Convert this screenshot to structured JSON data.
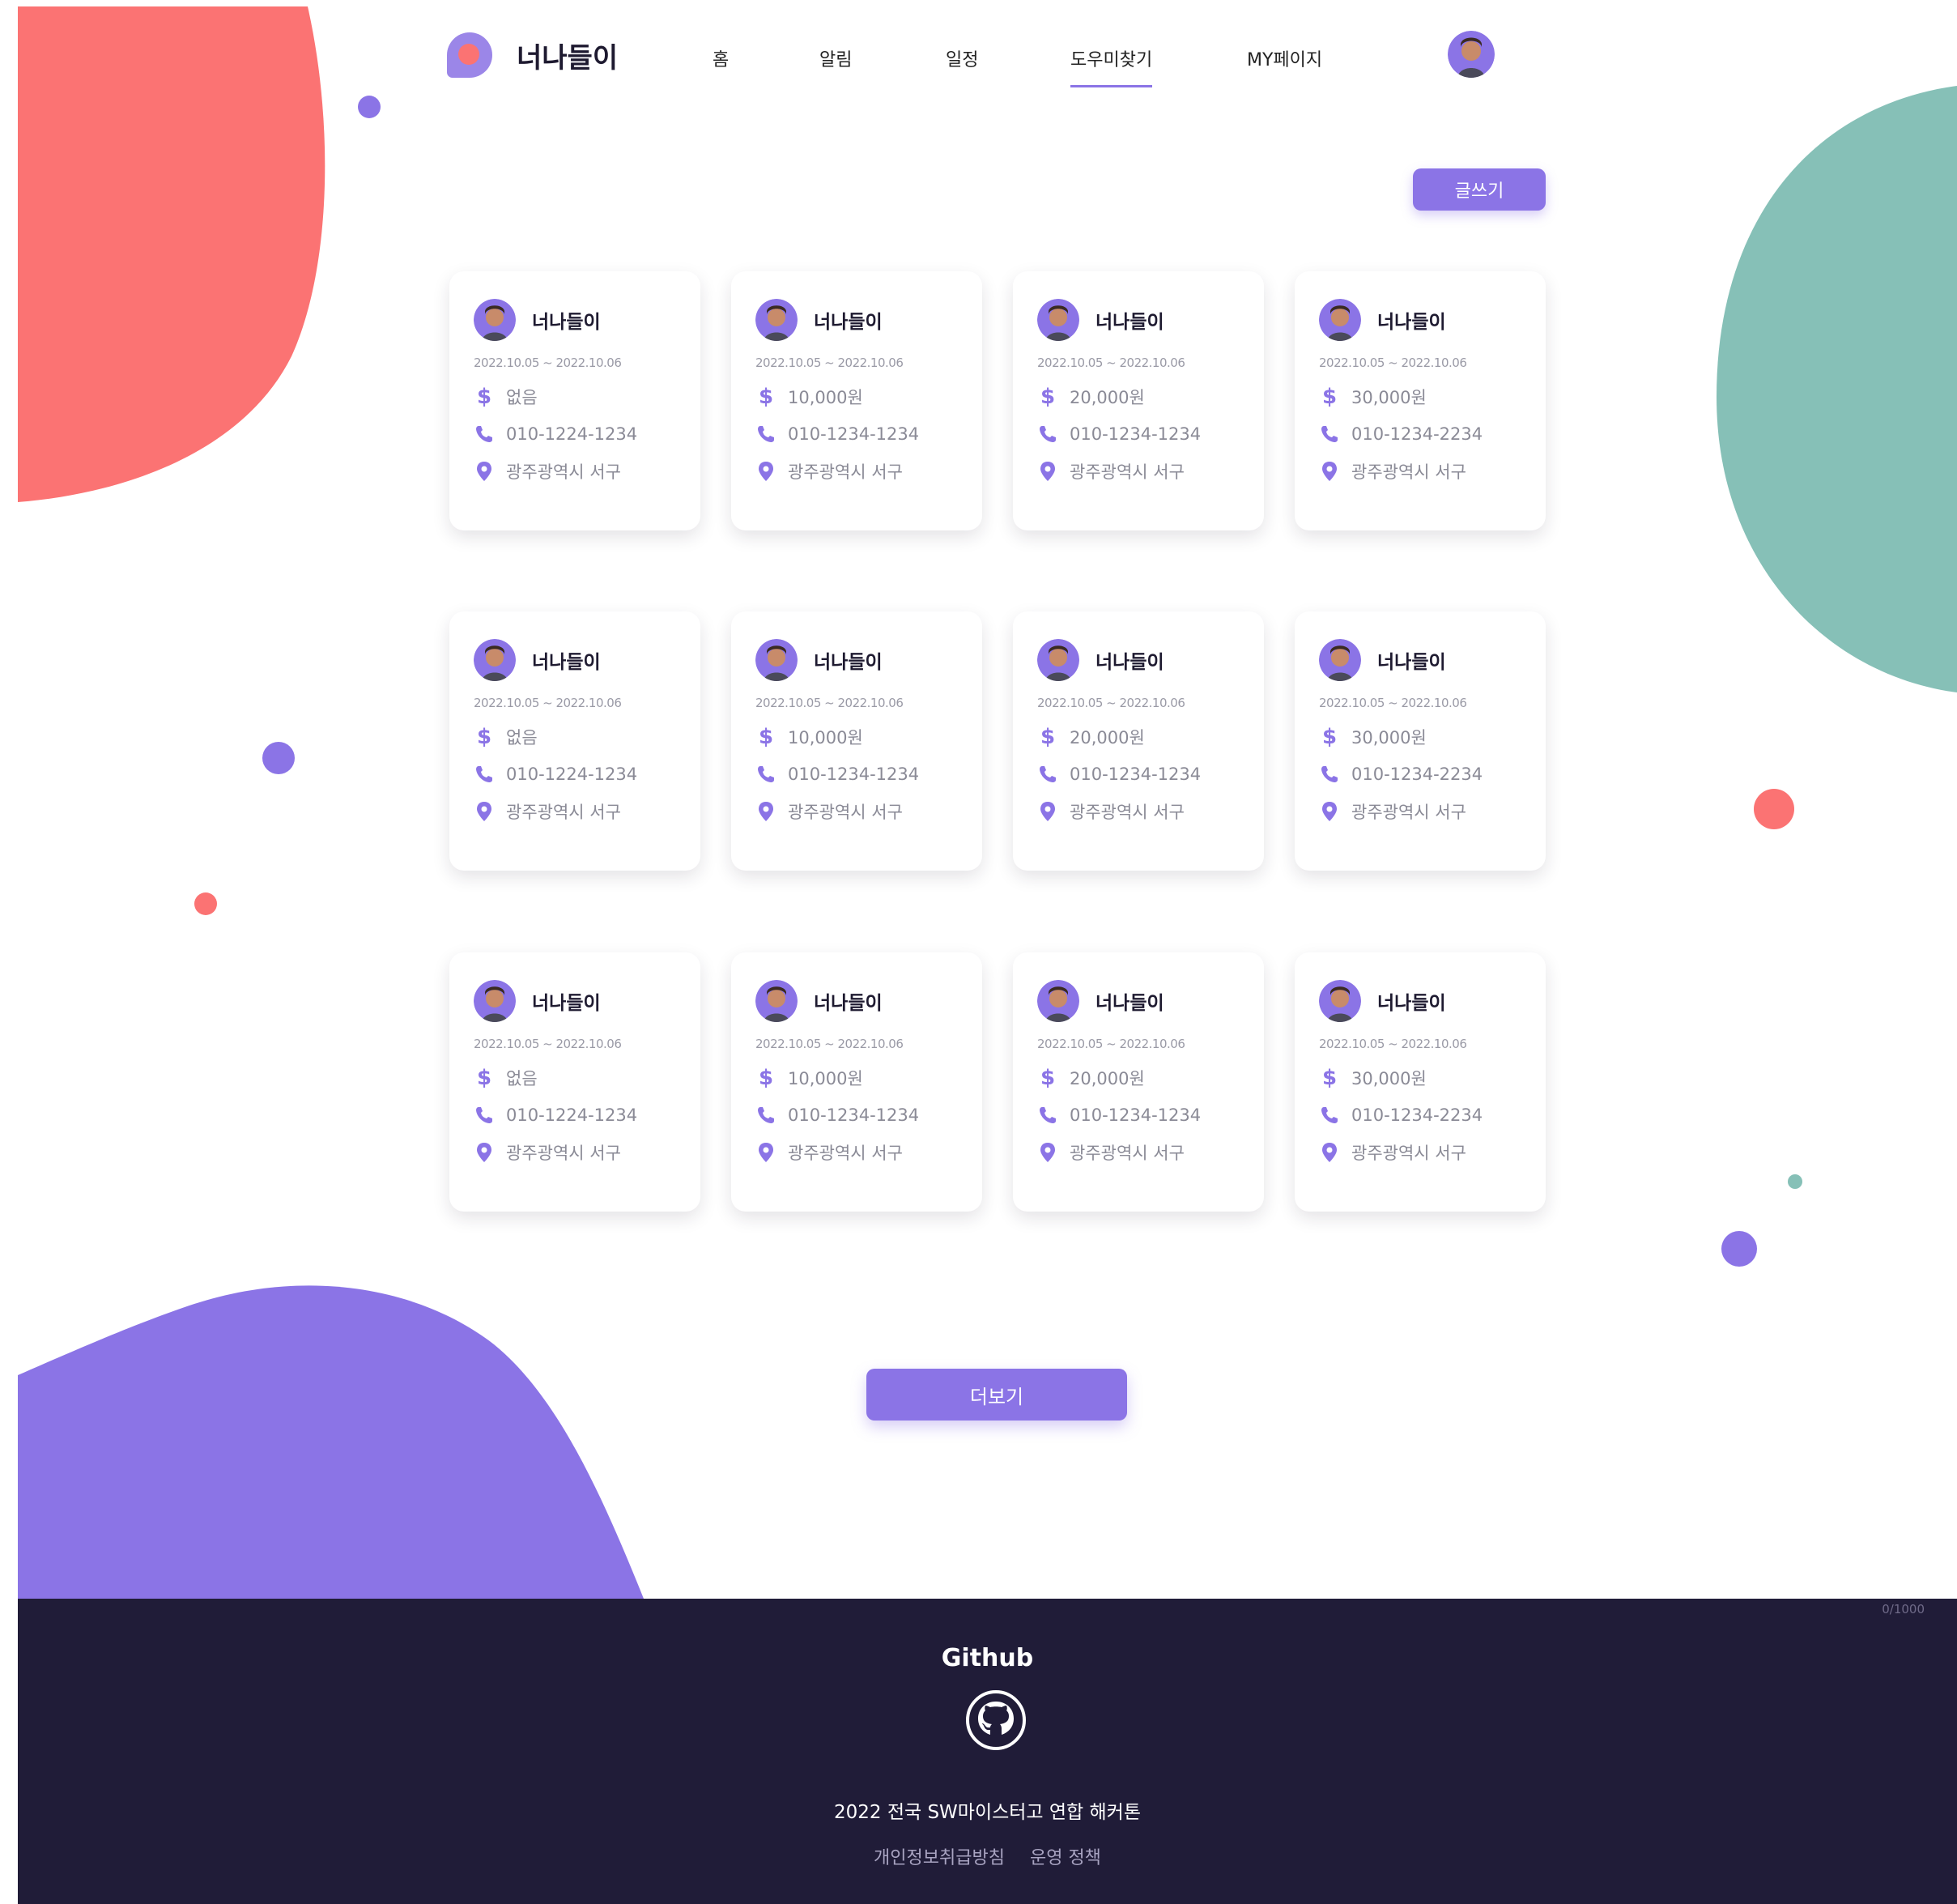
{
  "header": {
    "brand": "너나들이",
    "nav": [
      "홈",
      "알림",
      "일정",
      "도우미찾기",
      "MY페이지"
    ],
    "active_nav": "도우미찾기"
  },
  "write_button": "글쓰기",
  "cards": [
    {
      "name": "너나들이",
      "date": "2022.10.05 ~ 2022.10.06",
      "pay": "없음",
      "phone": "010-1224-1234",
      "location": "광주광역시 서구"
    },
    {
      "name": "너나들이",
      "date": "2022.10.05 ~ 2022.10.06",
      "pay": "10,000원",
      "phone": "010-1234-1234",
      "location": "광주광역시 서구"
    },
    {
      "name": "너나들이",
      "date": "2022.10.05 ~ 2022.10.06",
      "pay": "20,000원",
      "phone": "010-1234-1234",
      "location": "광주광역시 서구"
    },
    {
      "name": "너나들이",
      "date": "2022.10.05 ~ 2022.10.06",
      "pay": "30,000원",
      "phone": "010-1234-2234",
      "location": "광주광역시 서구"
    },
    {
      "name": "너나들이",
      "date": "2022.10.05 ~ 2022.10.06",
      "pay": "없음",
      "phone": "010-1224-1234",
      "location": "광주광역시 서구"
    },
    {
      "name": "너나들이",
      "date": "2022.10.05 ~ 2022.10.06",
      "pay": "10,000원",
      "phone": "010-1234-1234",
      "location": "광주광역시 서구"
    },
    {
      "name": "너나들이",
      "date": "2022.10.05 ~ 2022.10.06",
      "pay": "20,000원",
      "phone": "010-1234-1234",
      "location": "광주광역시 서구"
    },
    {
      "name": "너나들이",
      "date": "2022.10.05 ~ 2022.10.06",
      "pay": "30,000원",
      "phone": "010-1234-2234",
      "location": "광주광역시 서구"
    },
    {
      "name": "너나들이",
      "date": "2022.10.05 ~ 2022.10.06",
      "pay": "없음",
      "phone": "010-1224-1234",
      "location": "광주광역시 서구"
    },
    {
      "name": "너나들이",
      "date": "2022.10.05 ~ 2022.10.06",
      "pay": "10,000원",
      "phone": "010-1234-1234",
      "location": "광주광역시 서구"
    },
    {
      "name": "너나들이",
      "date": "2022.10.05 ~ 2022.10.06",
      "pay": "20,000원",
      "phone": "010-1234-1234",
      "location": "광주광역시 서구"
    },
    {
      "name": "너나들이",
      "date": "2022.10.05 ~ 2022.10.06",
      "pay": "30,000원",
      "phone": "010-1234-2234",
      "location": "광주광역시 서구"
    }
  ],
  "more_button": "더보기",
  "footer": {
    "counter": "0/1000",
    "github_title": "Github",
    "event": "2022 전국 SW마이스터고 연합 해커톤",
    "links": [
      "개인정보취급방침",
      "운영 정책"
    ]
  },
  "colors": {
    "accent": "#8b74e6",
    "coral": "#fb7373",
    "teal": "#86c0b7",
    "footer_bg": "#201c38"
  }
}
